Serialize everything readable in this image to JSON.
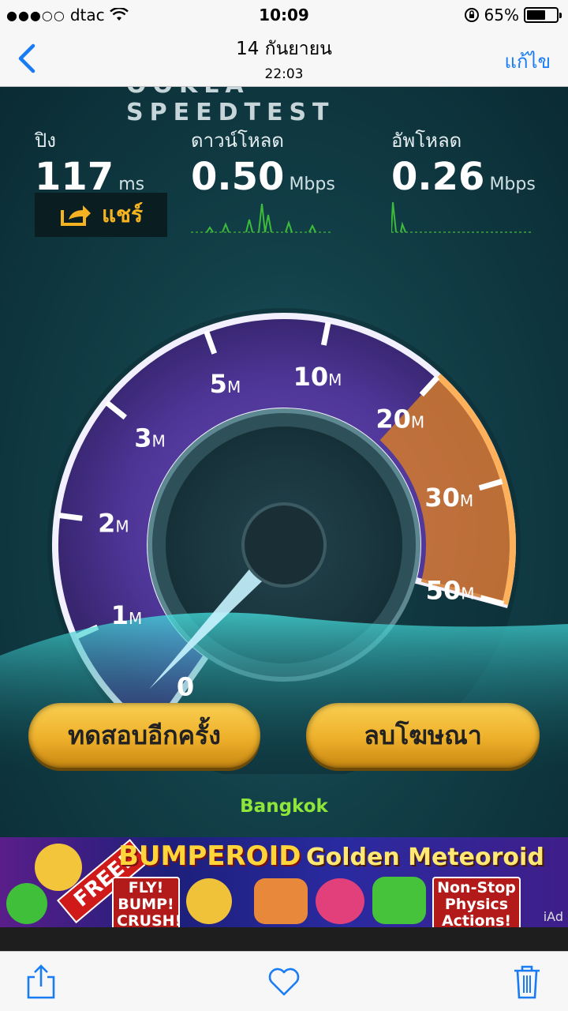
{
  "status_bar": {
    "carrier": "dtac",
    "signal_dots": "●●●○○",
    "time": "10:09",
    "battery_percent": "65%",
    "battery_level": 0.65
  },
  "nav": {
    "title": "14 กันยายน",
    "subtitle": "22:03",
    "edit_label": "แก้ไข"
  },
  "speedtest": {
    "brand": "OOKLA SPEEDTEST",
    "ping": {
      "label": "ปิง",
      "value": "117",
      "unit": "ms"
    },
    "download": {
      "label": "ดาวน์โหลด",
      "value": "0.50",
      "unit": "Mbps"
    },
    "upload": {
      "label": "อัพโหลด",
      "value": "0.26",
      "unit": "Mbps"
    },
    "share_label": "แชร์",
    "gauge": {
      "ticks": [
        {
          "num": "0",
          "unit": ""
        },
        {
          "num": "1",
          "unit": "M"
        },
        {
          "num": "2",
          "unit": "M"
        },
        {
          "num": "3",
          "unit": "M"
        },
        {
          "num": "5",
          "unit": "M"
        },
        {
          "num": "10",
          "unit": "M"
        },
        {
          "num": "20",
          "unit": "M"
        },
        {
          "num": "30",
          "unit": "M"
        },
        {
          "num": "50",
          "unit": "M"
        }
      ],
      "needle_value": 0.26
    },
    "retest_label": "ทดสอบอีกครั้ง",
    "remove_ads_label": "ลบโฆษณา",
    "city": "Bangkok"
  },
  "ad": {
    "title": "BUMPEROID",
    "title2": "Golden Meteoroid",
    "free_label": "FREE!",
    "box1": "FLY! BUMP! CRUSH!",
    "box2": "Non-Stop Physics Actions!",
    "iad": "iAd"
  },
  "colors": {
    "accent_blue": "#1a7cf5",
    "gold": "#f6b321",
    "green": "#8ee63a",
    "gauge_purple": "#5b3fa6",
    "gauge_orange": "#e08a2a"
  },
  "icons": [
    "back-chevron-icon",
    "wifi-icon",
    "orientation-lock-icon",
    "share-arrow-icon",
    "share-icon",
    "heart-icon",
    "trash-icon"
  ]
}
